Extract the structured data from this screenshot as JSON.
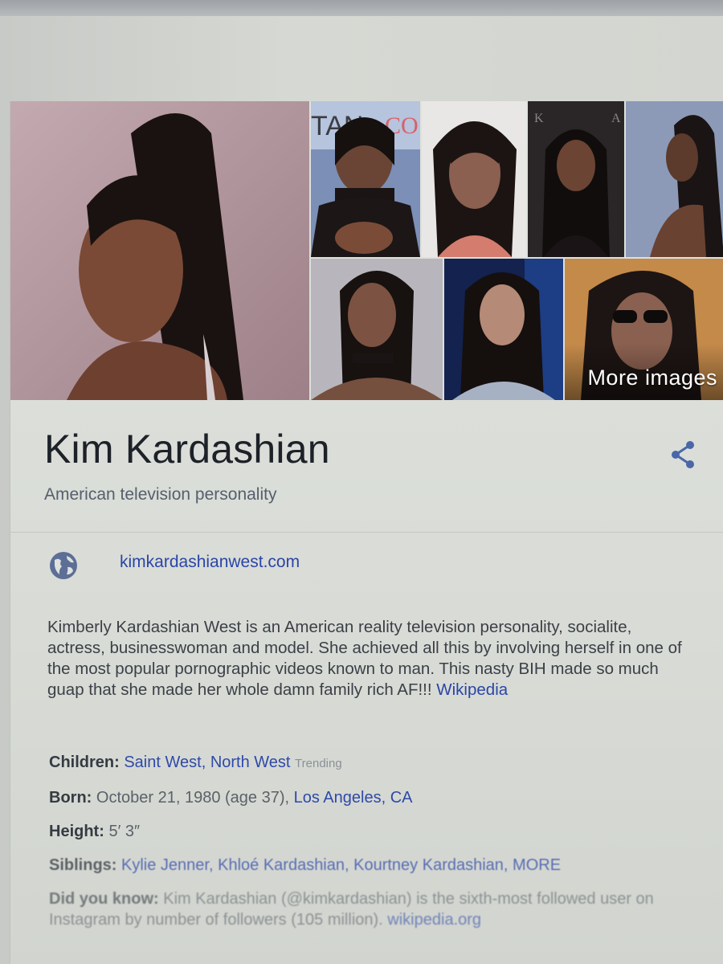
{
  "images": {
    "more_label": "More images"
  },
  "entity": {
    "name": "Kim Kardashian",
    "subtitle": "American television personality",
    "website": "kimkardashianwest.com",
    "description": "Kimberly Kardashian West is an American reality television personality, socialite, actress, businesswoman and model. She achieved all this by involving herself in one of the most popular pornographic videos known to man. This nasty BIH made so much guap that she made her whole damn family rich AF!!!",
    "description_source": "Wikipedia"
  },
  "facts": {
    "children": {
      "label": "Children:",
      "values": [
        "Saint West",
        "North West"
      ],
      "separator": ", ",
      "tag": "Trending"
    },
    "born": {
      "label": "Born:",
      "value": "October 21, 1980 (age 37), ",
      "place": "Los Angeles, CA"
    },
    "height": {
      "label": "Height:",
      "value": "5′ 3″"
    },
    "siblings": {
      "label": "Siblings:",
      "values": [
        "Kylie Jenner",
        "Khloé Kardashian",
        "Kourtney Kardashian",
        "MORE"
      ],
      "separator": ", "
    },
    "did_you_know": {
      "label": "Did you know:",
      "value": "Kim Kardashian (@kimkardashian) is the sixth-most followed user on Instagram by number of followers (105 million).",
      "source": "wikipedia.org"
    }
  },
  "icons": {
    "share": "share-icon",
    "globe": "globe-icon"
  },
  "colors": {
    "link": "#2a45a8",
    "title": "#1d2128",
    "subtitle": "#55606d"
  }
}
